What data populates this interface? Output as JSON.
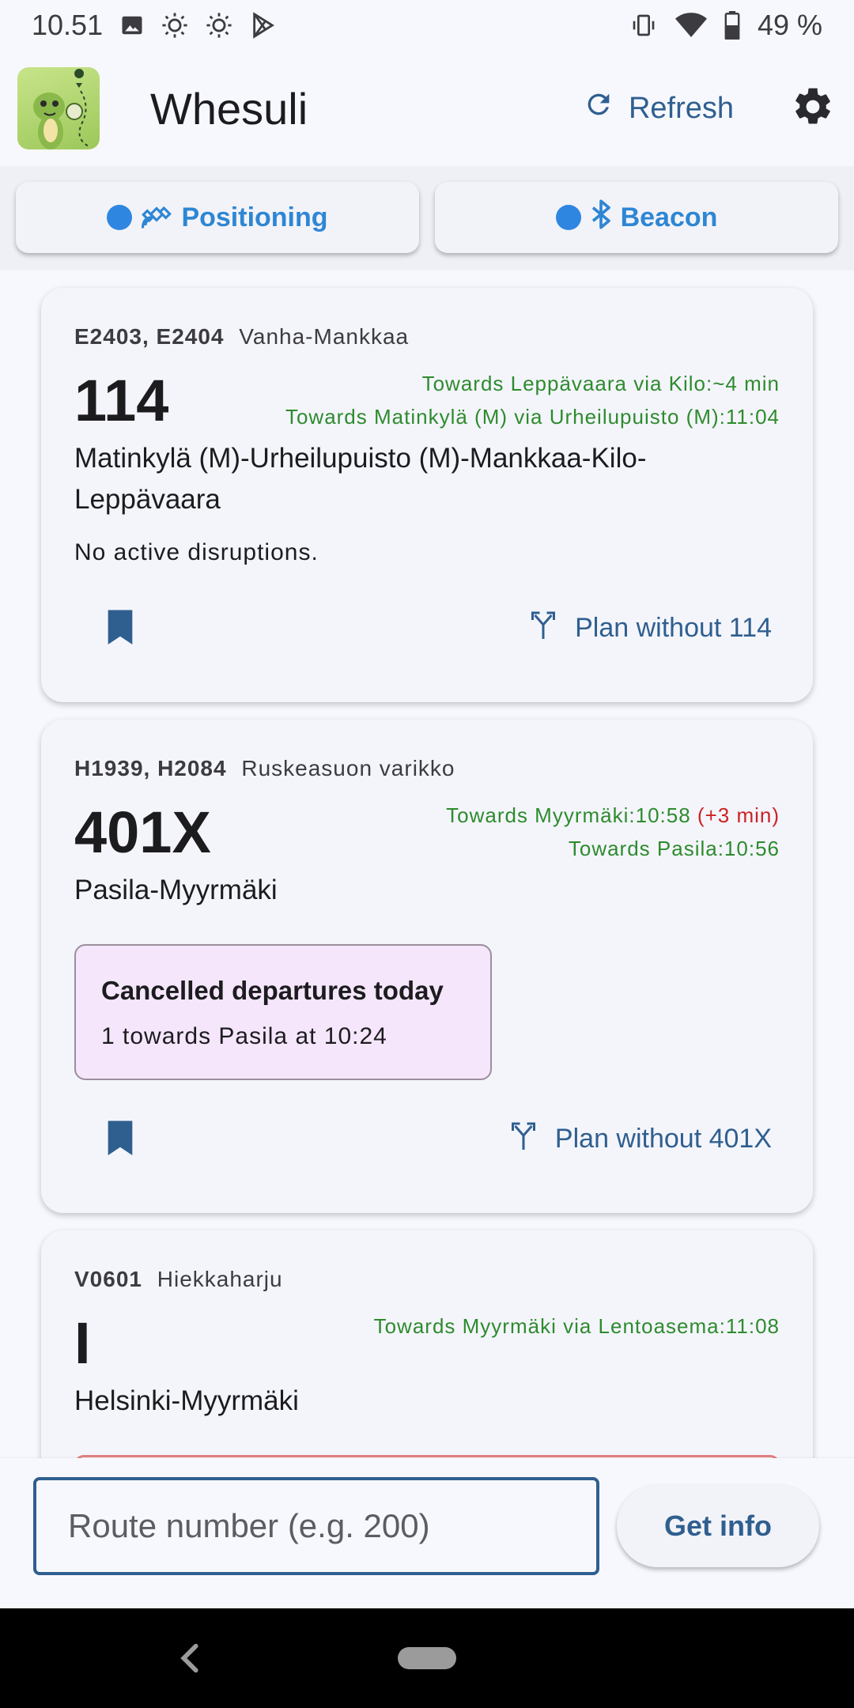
{
  "status_bar": {
    "time": "10.51",
    "battery": "49 %"
  },
  "app": {
    "title": "Whesuli",
    "refresh_label": "Refresh"
  },
  "segments": {
    "positioning_label": "Positioning",
    "beacon_label": "Beacon"
  },
  "cards": [
    {
      "vehicles": "E2403, E2404",
      "depot": "Vanha-Mankkaa",
      "route": "114",
      "departures": [
        {
          "text": "Towards Leppävaara via Kilo:~4 min"
        },
        {
          "text": "Towards Matinkylä (M) via Urheilupuisto (M):11:04"
        }
      ],
      "name_line1": "Matinkylä (M)-Urheilupuisto (M)-Mankkaa-Kilo-",
      "name_line2": "Leppävaara",
      "disruption": "No active disruptions.",
      "plan_label": "Plan without 114"
    },
    {
      "vehicles": "H1939, H2084",
      "depot": "Ruskeasuon varikko",
      "route": "401X",
      "departures": [
        {
          "text": "Towards Myyrmäki:10:58",
          "delay": "(+3 min)"
        },
        {
          "text": "Towards Pasila:10:56"
        }
      ],
      "name_line1": "Pasila-Myyrmäki",
      "cancel_title": "Cancelled departures today",
      "cancel_text": "1 towards Pasila at 10:24",
      "plan_label": "Plan without 401X"
    },
    {
      "vehicles": "V0601",
      "depot": "Hiekkaharju",
      "route": "I",
      "departures": [
        {
          "text": "Towards Myyrmäki via Lentoasema:11:08"
        }
      ],
      "name_line1": "Helsinki-Myyrmäki"
    }
  ],
  "search": {
    "placeholder": "Route number (e.g. 200)",
    "button_label": "Get info"
  },
  "colors": {
    "accent": "#2f5f8f",
    "departure_green": "#2e8b2e",
    "delay_red": "#cc2222",
    "dot_blue": "#2e86e0"
  }
}
